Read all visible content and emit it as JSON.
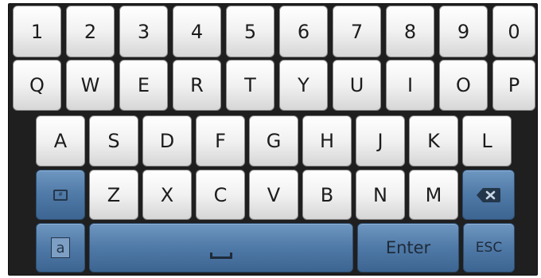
{
  "keyboard": {
    "row1": [
      "1",
      "2",
      "3",
      "4",
      "5",
      "6",
      "7",
      "8",
      "9",
      "0"
    ],
    "row2": [
      "Q",
      "W",
      "E",
      "R",
      "T",
      "Y",
      "U",
      "I",
      "O",
      "P"
    ],
    "row3": [
      "A",
      "S",
      "D",
      "F",
      "G",
      "H",
      "J",
      "K",
      "L"
    ],
    "row4": [
      "Z",
      "X",
      "C",
      "V",
      "B",
      "N",
      "M"
    ],
    "mode_icon_text": "#",
    "case_label": "a",
    "enter_label": "Enter",
    "esc_label": "ESC"
  },
  "colors": {
    "letter_key": "#f1f1f1",
    "function_key": "#4f79a6",
    "background": "#1f1f1f"
  }
}
